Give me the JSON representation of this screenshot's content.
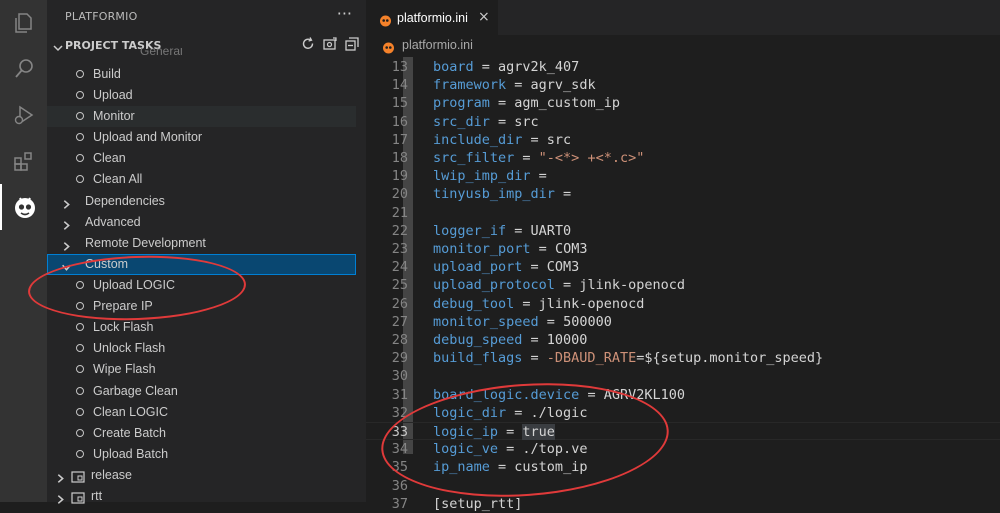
{
  "sidebar": {
    "title": "PLATFORMIO",
    "more": "···",
    "section_title": "PROJECT TASKS",
    "partial_row": "General",
    "tasks": [
      {
        "label": "Build"
      },
      {
        "label": "Upload"
      },
      {
        "label": "Monitor"
      },
      {
        "label": "Upload and Monitor"
      },
      {
        "label": "Clean"
      },
      {
        "label": "Clean All"
      }
    ],
    "groups": [
      {
        "label": "Dependencies"
      },
      {
        "label": "Advanced"
      },
      {
        "label": "Remote Development"
      },
      {
        "label": "Custom"
      }
    ],
    "custom_tasks": [
      {
        "label": "Upload LOGIC"
      },
      {
        "label": "Prepare IP"
      },
      {
        "label": "Lock Flash"
      },
      {
        "label": "Unlock Flash"
      },
      {
        "label": "Wipe Flash"
      },
      {
        "label": "Garbage Clean"
      },
      {
        "label": "Clean LOGIC"
      },
      {
        "label": "Create Batch"
      },
      {
        "label": "Upload Batch"
      }
    ],
    "envs": [
      {
        "label": "release"
      },
      {
        "label": "rtt"
      }
    ]
  },
  "editor": {
    "tab_label": "platformio.ini",
    "tab_close": "×",
    "breadcrumb": "platformio.ini",
    "lines": [
      {
        "n": "13",
        "key": "board",
        "sep": " = ",
        "val": "agrv2k_407",
        "str": ""
      },
      {
        "n": "14",
        "key": "framework",
        "sep": " = ",
        "val": "agrv_sdk",
        "str": ""
      },
      {
        "n": "15",
        "key": "program",
        "sep": " = ",
        "val": "agm_custom_ip",
        "str": ""
      },
      {
        "n": "16",
        "key": "src_dir",
        "sep": " = ",
        "val": "src",
        "str": ""
      },
      {
        "n": "17",
        "key": "include_dir",
        "sep": " = ",
        "val": "src",
        "str": ""
      },
      {
        "n": "18",
        "key": "src_filter",
        "sep": " = ",
        "val": "",
        "str": "\"-<*> +<*.c>\""
      },
      {
        "n": "19",
        "key": "lwip_imp_dir",
        "sep": " =",
        "val": "",
        "str": ""
      },
      {
        "n": "20",
        "key": "tinyusb_imp_dir",
        "sep": " =",
        "val": "",
        "str": ""
      },
      {
        "n": "21",
        "key": "",
        "sep": "",
        "val": "",
        "str": ""
      },
      {
        "n": "22",
        "key": "logger_if",
        "sep": " = ",
        "val": "UART0",
        "str": ""
      },
      {
        "n": "23",
        "key": "monitor_port",
        "sep": " = ",
        "val": "COM3",
        "str": ""
      },
      {
        "n": "24",
        "key": "upload_port",
        "sep": " = ",
        "val": "COM3",
        "str": ""
      },
      {
        "n": "25",
        "key": "upload_protocol",
        "sep": " = ",
        "val": "jlink-openocd",
        "str": ""
      },
      {
        "n": "26",
        "key": "debug_tool",
        "sep": " = ",
        "val": "jlink-openocd",
        "str": ""
      },
      {
        "n": "27",
        "key": "monitor_speed",
        "sep": " = ",
        "val": "500000",
        "str": ""
      },
      {
        "n": "28",
        "key": "debug_speed",
        "sep": " = ",
        "val": "10000",
        "str": ""
      },
      {
        "n": "29",
        "key": "build_flags",
        "sep": " = ",
        "val": "",
        "str": "-DBAUD_RATE",
        "tail": "=${setup.monitor_speed}"
      },
      {
        "n": "30",
        "key": "",
        "sep": "",
        "val": "",
        "str": ""
      },
      {
        "n": "31",
        "key": "board_logic.device",
        "sep": " = ",
        "val": "AGRV2KL100",
        "str": ""
      },
      {
        "n": "32",
        "key": "logic_dir",
        "sep": " = ",
        "val": "./logic",
        "str": ""
      },
      {
        "n": "33",
        "key": "logic_ip",
        "sep": " = ",
        "val": "true",
        "str": "",
        "current": true
      },
      {
        "n": "34",
        "key": "logic_ve",
        "sep": " = ",
        "val": "./top.ve",
        "str": ""
      },
      {
        "n": "35",
        "key": "ip_name",
        "sep": " = ",
        "val": "custom_ip",
        "str": ""
      },
      {
        "n": "36",
        "key": "",
        "sep": "",
        "val": "",
        "str": ""
      },
      {
        "n": "37",
        "key": "",
        "sep": "",
        "val": "[setup_rtt]",
        "str": ""
      }
    ]
  },
  "colors": {
    "annotation": "#e03a3a",
    "selection": "#094771",
    "key": "#569cd6",
    "string": "#ce9178"
  }
}
